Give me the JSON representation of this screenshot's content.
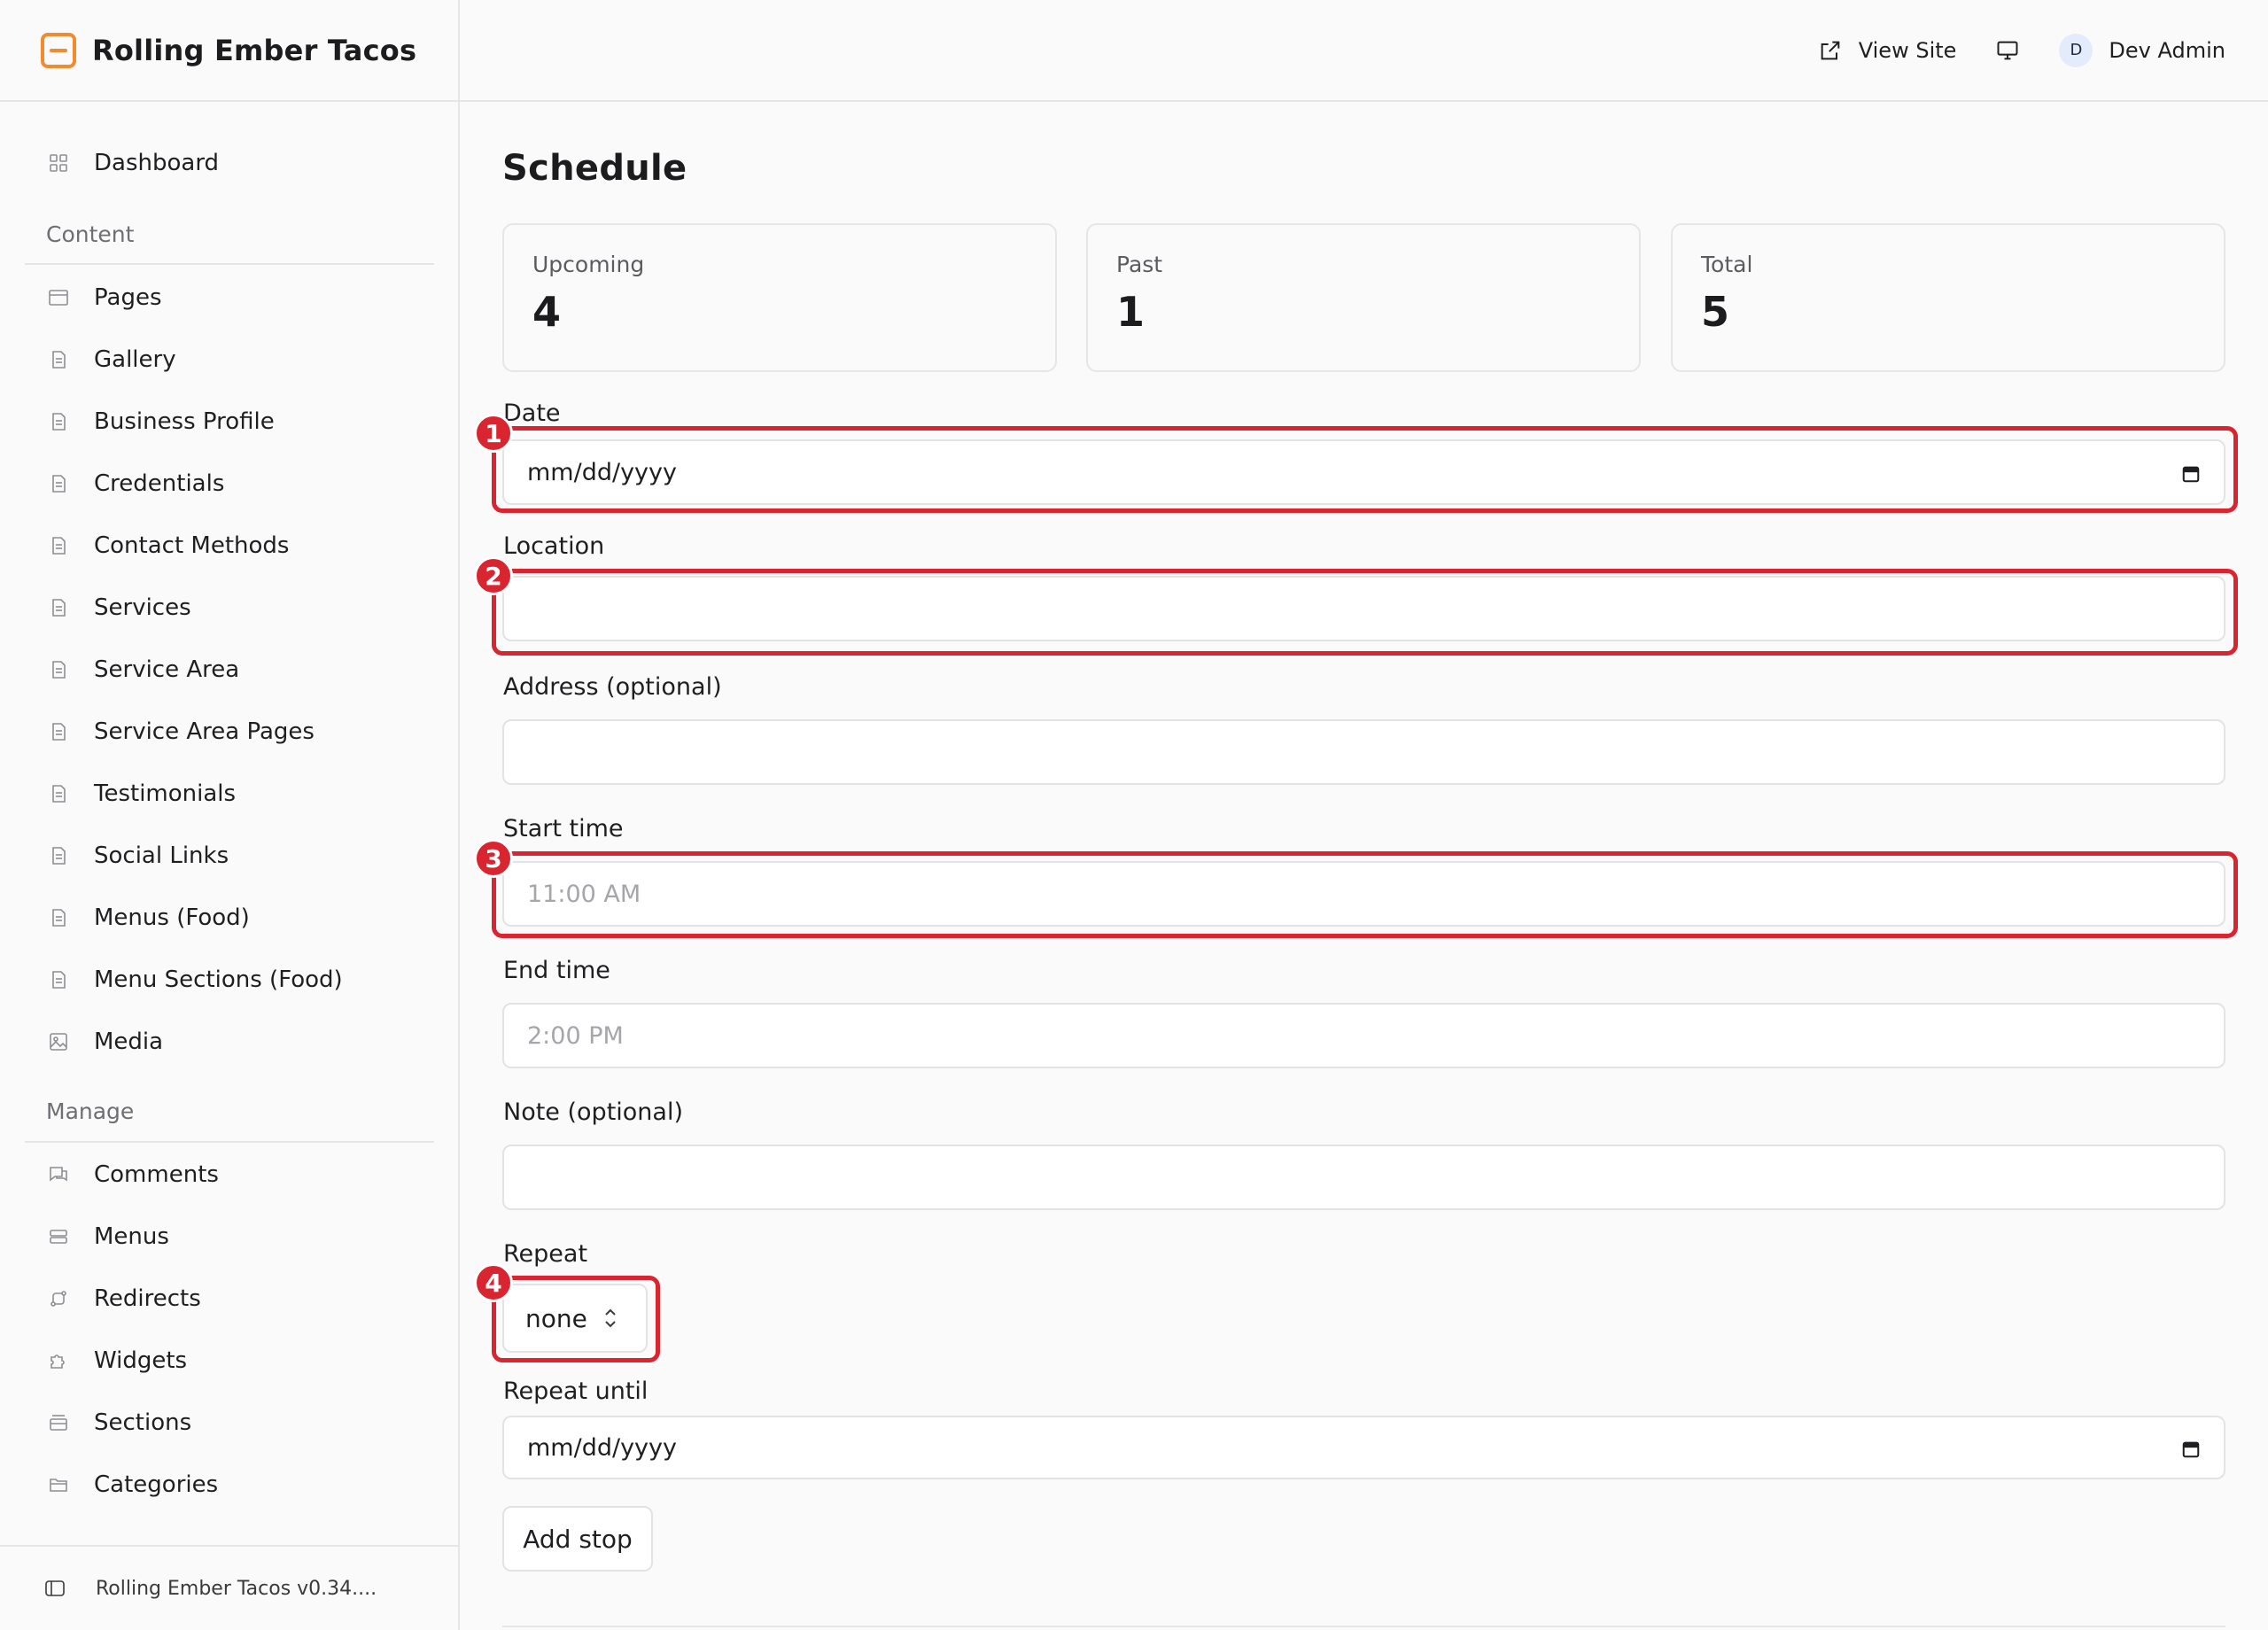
{
  "app": {
    "brand": "Rolling Ember Tacos",
    "footer_text": "Rolling Ember Tacos v0.34....",
    "accent_color": "#f28a2e",
    "annotation_color": "#d9252f"
  },
  "topbar": {
    "view_site": "View Site",
    "user_initial": "D",
    "user_name": "Dev Admin"
  },
  "sidebar": {
    "top_item": {
      "label": "Dashboard",
      "icon": "grid-icon"
    },
    "sections": {
      "content": "Content",
      "manage": "Manage"
    },
    "content_items": [
      {
        "label": "Pages",
        "icon": "browser-icon"
      },
      {
        "label": "Gallery",
        "icon": "document-icon"
      },
      {
        "label": "Business Profile",
        "icon": "document-icon"
      },
      {
        "label": "Credentials",
        "icon": "document-icon"
      },
      {
        "label": "Contact Methods",
        "icon": "document-icon"
      },
      {
        "label": "Services",
        "icon": "document-icon"
      },
      {
        "label": "Service Area",
        "icon": "document-icon"
      },
      {
        "label": "Service Area Pages",
        "icon": "document-icon"
      },
      {
        "label": "Testimonials",
        "icon": "document-icon"
      },
      {
        "label": "Social Links",
        "icon": "document-icon"
      },
      {
        "label": "Menus (Food)",
        "icon": "document-icon"
      },
      {
        "label": "Menu Sections (Food)",
        "icon": "document-icon"
      },
      {
        "label": "Media",
        "icon": "image-icon"
      }
    ],
    "manage_items": [
      {
        "label": "Comments",
        "icon": "comments-icon"
      },
      {
        "label": "Menus",
        "icon": "menu-stack-icon"
      },
      {
        "label": "Redirects",
        "icon": "redirect-icon"
      },
      {
        "label": "Widgets",
        "icon": "puzzle-icon"
      },
      {
        "label": "Sections",
        "icon": "sections-icon"
      },
      {
        "label": "Categories",
        "icon": "folder-icon"
      }
    ]
  },
  "main": {
    "title": "Schedule",
    "stats": [
      {
        "label": "Upcoming",
        "value": "4"
      },
      {
        "label": "Past",
        "value": "1"
      },
      {
        "label": "Total",
        "value": "5"
      }
    ],
    "form": {
      "date_label": "Date",
      "date_value": "mm/dd/yyyy",
      "location_label": "Location",
      "location_value": "",
      "address_label": "Address (optional)",
      "address_value": "",
      "start_label": "Start time",
      "start_placeholder": "11:00 AM",
      "end_label": "End time",
      "end_placeholder": "2:00 PM",
      "note_label": "Note (optional)",
      "note_value": "",
      "repeat_label": "Repeat",
      "repeat_value": "none",
      "repeat_until_label": "Repeat until",
      "repeat_until_value": "mm/dd/yyyy",
      "add_stop": "Add stop"
    },
    "annotations": [
      "1",
      "2",
      "3",
      "4"
    ]
  }
}
